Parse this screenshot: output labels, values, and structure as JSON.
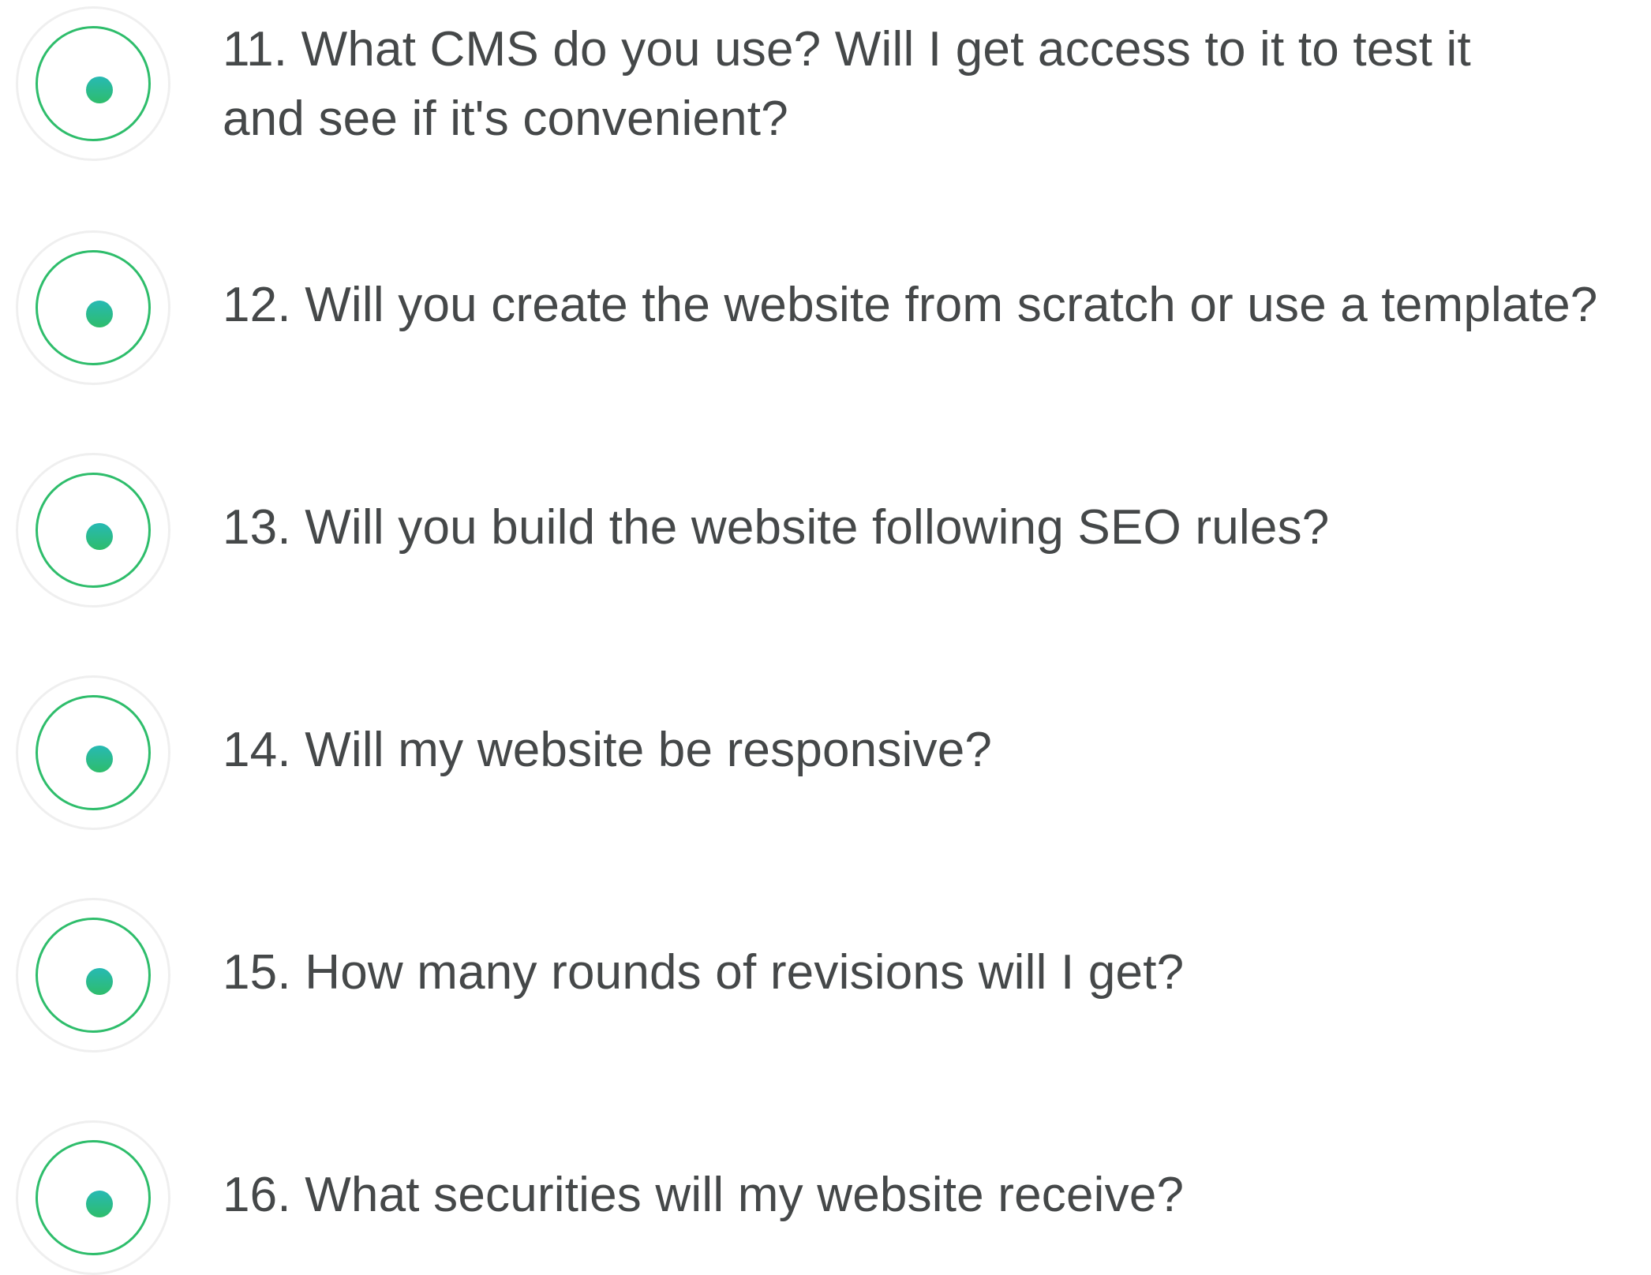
{
  "faq": {
    "items": [
      {
        "number": "11.",
        "lines": [
          "11. What CMS do you use? Will I get access to it to test it",
          "and see if it's convenient?"
        ]
      },
      {
        "number": "12.",
        "lines": [
          "12. Will you create the website from scratch or use a template?"
        ]
      },
      {
        "number": "13.",
        "lines": [
          "13. Will you build the website following SEO rules?"
        ]
      },
      {
        "number": "14.",
        "lines": [
          "14. Will my website be responsive?"
        ]
      },
      {
        "number": "15.",
        "lines": [
          "15. How many rounds of revisions will I get?"
        ]
      },
      {
        "number": "16.",
        "lines": [
          "16. What securities will my website receive?"
        ]
      }
    ]
  },
  "colors": {
    "ring": "#2ebd6b",
    "dot_top": "#27b9b4",
    "dot_bottom": "#2ebd6b",
    "outer_ring": "#efefef",
    "text": "#454849"
  },
  "icons": {
    "marker": "radio-dot-icon"
  }
}
